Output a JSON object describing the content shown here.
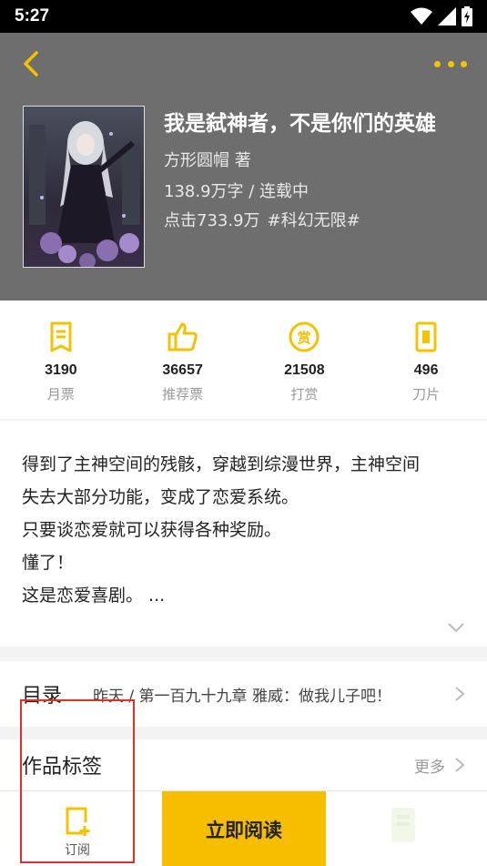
{
  "status_bar": {
    "time": "5:27"
  },
  "book": {
    "title": "我是弑神者，不是你们的英雄",
    "author_line": "方形圆帽  著",
    "words_status": "138.9万字 / 连载中",
    "clicks": "点击733.9万",
    "category": "#科幻无限#"
  },
  "stats": [
    {
      "icon": "monthly-ticket-icon",
      "value": "3190",
      "label": "月票"
    },
    {
      "icon": "thumbs-up-icon",
      "value": "36657",
      "label": "推荐票"
    },
    {
      "icon": "reward-coin-icon",
      "value": "21508",
      "label": "打赏"
    },
    {
      "icon": "blade-ticket-icon",
      "value": "496",
      "label": "刀片"
    }
  ],
  "description": {
    "lines": [
      "得到了主神空间的残骸，穿越到综漫世界，主神空间",
      "失去大部分功能，变成了恋爱系统。",
      "只要谈恋爱就可以获得各种奖励。",
      "懂了！",
      "这是恋爱喜剧。 ..."
    ]
  },
  "catalog": {
    "title": "目录",
    "latest_chapter": "昨天 / 第一百九十九章 雅威：做我儿子吧！"
  },
  "tags_section": {
    "title": "作品标签",
    "more_label": "更多"
  },
  "bottom_bar": {
    "subscribe_label": "订阅",
    "read_now_label": "立即阅读"
  },
  "colors": {
    "accent": "#f5c200",
    "header_bg": "#6e6e6e",
    "highlight": "#e0302e"
  }
}
